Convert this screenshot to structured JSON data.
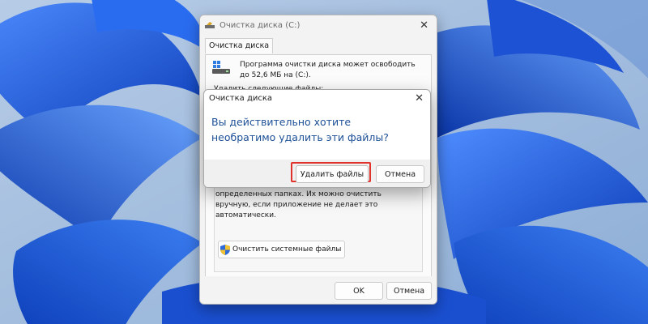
{
  "main_window": {
    "title": "Очистка диска  (C:)",
    "tab": "Очистка диска",
    "intro": "Программа очистки диска может освободить до 52,6 МБ на  (C:).",
    "files_label": "Удалить следующие файлы:",
    "description": "определенных папках. Их можно очистить вручную, если приложение не делает это автоматически.",
    "system_button": "Очистить системные файлы",
    "ok_button": "OK",
    "cancel_button": "Отмена",
    "close_icon": "close-icon",
    "drive_icon": "drive-icon"
  },
  "dialog": {
    "title": "Очистка диска",
    "question": "Вы действительно хотите необратимо удалить эти файлы?",
    "delete_button": "Удалить файлы",
    "cancel_button": "Отмена",
    "highlight_color": "#e0322b"
  },
  "colors": {
    "accent_text": "#1c4f96",
    "wallpaper_blue": "#1f5fd8",
    "background": "#a9c3df"
  }
}
